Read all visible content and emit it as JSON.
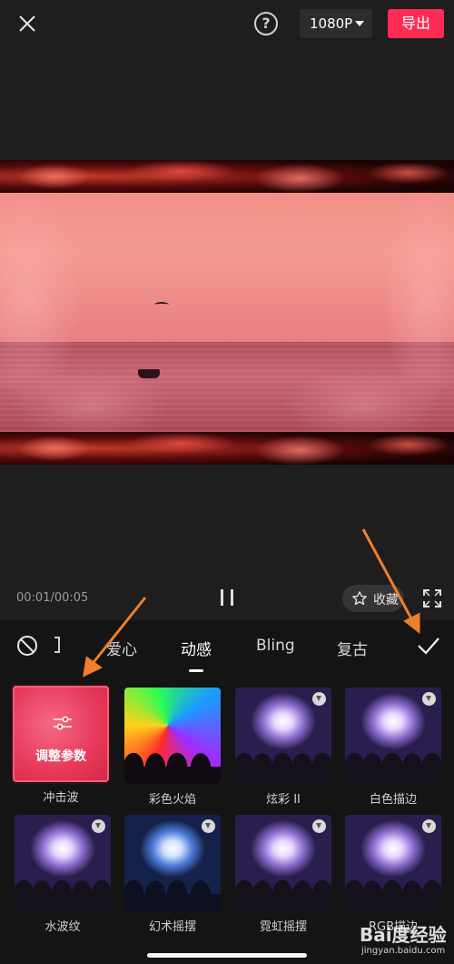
{
  "topbar": {
    "help_symbol": "?",
    "resolution": "1080P",
    "export_label": "导出",
    "accent": "#fe2c55"
  },
  "player": {
    "time": "00:01/00:05",
    "favorite_label": "收藏"
  },
  "tabs": [
    {
      "label": "爱心",
      "active": false
    },
    {
      "label": "动感",
      "active": true
    },
    {
      "label": "Bling",
      "active": false
    },
    {
      "label": "复古",
      "active": false
    }
  ],
  "effects": [
    {
      "name": "冲击波",
      "selected": true,
      "overlay_label": "调整参数",
      "downloaded": true
    },
    {
      "name": "彩色火焰",
      "selected": false,
      "downloaded": true
    },
    {
      "name": "炫彩 II",
      "selected": false,
      "downloaded": false
    },
    {
      "name": "白色描边",
      "selected": false,
      "downloaded": false
    },
    {
      "name": "水波纹",
      "selected": false,
      "downloaded": false
    },
    {
      "name": "幻术摇摆",
      "selected": false,
      "downloaded": false
    },
    {
      "name": "霓虹摇摆",
      "selected": false,
      "downloaded": false
    },
    {
      "name": "RGB描边",
      "selected": false,
      "downloaded": false
    }
  ],
  "watermark": {
    "line1": "Bai度经验",
    "line2": "jingyan.baidu.com"
  },
  "colors": {
    "annotation_arrow": "#f07f2a",
    "selected_border": "#ff5c7a"
  }
}
